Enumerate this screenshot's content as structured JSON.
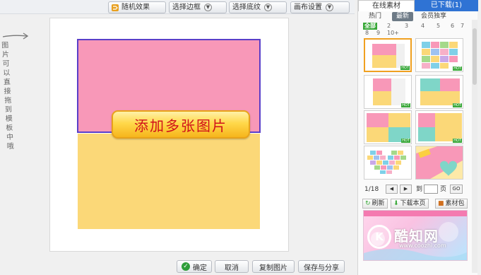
{
  "toolbar": {
    "random_effect": "随机效果",
    "select_border": "选择边框",
    "select_background": "选择底纹",
    "canvas_settings": "画布设置"
  },
  "canvas": {
    "add_photos": "添加多张图片",
    "top_color": "#f898b8",
    "bottom_color": "#fbd878",
    "border_color": "#5a3fc8"
  },
  "hint": "图片可以直接拖到模板中哦",
  "bottom_buttons": {
    "confirm": "确定",
    "cancel": "取消",
    "copy_image": "复制图片",
    "save_share": "保存与分享"
  },
  "panel": {
    "tab_online": "在线素材",
    "tab_downloaded": "已下载(1)",
    "subtabs": [
      "热门",
      "最新",
      "会员独享"
    ],
    "counts_row1": [
      "全部",
      "2",
      "3",
      "4",
      "5",
      "6",
      "7"
    ],
    "counts_row2": [
      "8",
      "9",
      "10+"
    ],
    "pager": {
      "page": "1/18",
      "goto": "到",
      "page_unit": "页",
      "go": "GO"
    },
    "actions": {
      "refresh": "刷新",
      "download_page": "下载本页",
      "material_pack": "素材包"
    },
    "accent": "#2f73d4",
    "thumb_tag": "HOT"
  },
  "watermark": {
    "logo": "K",
    "name": "酷知网",
    "url": "www.coozhi.com"
  }
}
